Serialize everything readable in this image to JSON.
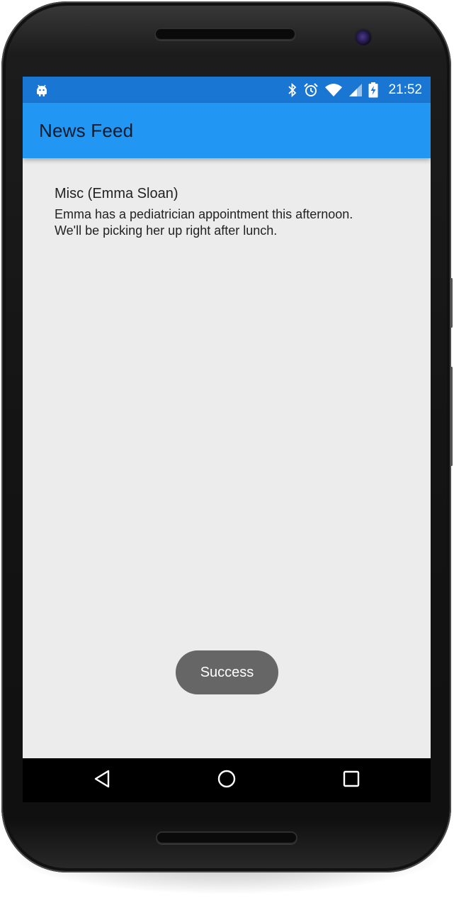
{
  "status_bar": {
    "time": "21:52",
    "icons": [
      "android-icon",
      "bluetooth-icon",
      "alarm-icon",
      "wifi-icon",
      "signal-icon",
      "battery-charging-icon"
    ]
  },
  "app_bar": {
    "title": "News Feed"
  },
  "feed": {
    "items": [
      {
        "title": "Misc (Emma Sloan)",
        "body": "Emma has a pediatrician appointment this afternoon.\nWe'll be picking her up right after lunch."
      }
    ]
  },
  "toast": {
    "text": "Success"
  },
  "nav_bar": {
    "buttons": [
      "back-icon",
      "home-icon",
      "recents-icon"
    ]
  },
  "colors": {
    "status_bar": "#1976d2",
    "app_bar": "#2196f3",
    "content_background": "#ececec",
    "toast_background": "#666666"
  }
}
